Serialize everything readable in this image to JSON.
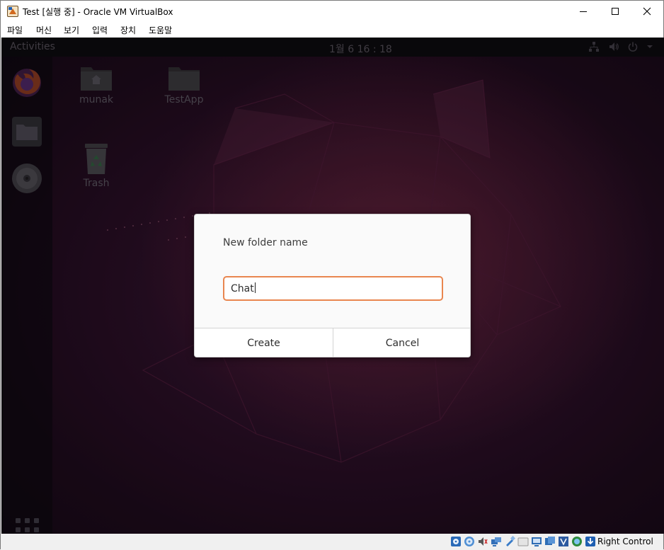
{
  "window": {
    "title": "Test [실행 중] - Oracle VM VirtualBox",
    "menu": [
      "파일",
      "머신",
      "보기",
      "입력",
      "장치",
      "도움말"
    ]
  },
  "guest": {
    "topbar": {
      "activities": "Activities",
      "clock": "1월 6  16 : 18"
    },
    "desktop_icons": [
      {
        "label": "munak"
      },
      {
        "label": "TestApp"
      },
      {
        "label": "Trash"
      }
    ],
    "dock": [
      "firefox-icon",
      "files-icon",
      "disc-icon"
    ]
  },
  "dialog": {
    "title": "New folder name",
    "input_value": "Chat",
    "create_label": "Create",
    "cancel_label": "Cancel",
    "focus_color": "#e9864f"
  },
  "statusbar": {
    "host_key": "Right Control"
  }
}
